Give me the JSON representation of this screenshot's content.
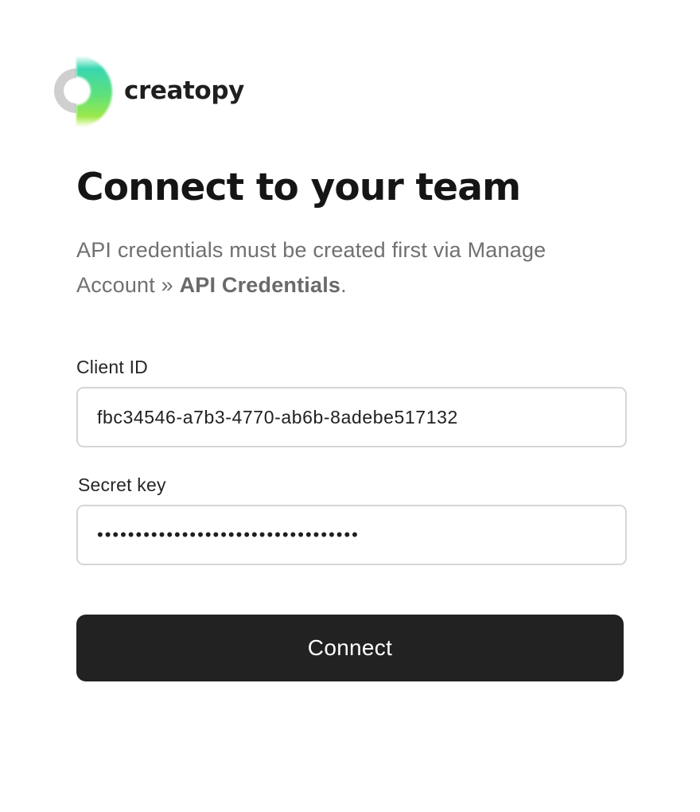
{
  "brand": {
    "name": "creatopy",
    "icon": "creatopy-logo-icon"
  },
  "header": {
    "title": "Connect to your team"
  },
  "description": {
    "text": "API credentials must be created first via Manage Account » ",
    "strong": "API Credentials",
    "suffix": "."
  },
  "form": {
    "client_id": {
      "label": "Client ID",
      "value": "fbc34546-a7b3-4770-ab6b-8adebe517132"
    },
    "secret_key": {
      "label": "Secret key",
      "value": "••••••••••••••••••••••••••••••••••"
    },
    "submit_label": "Connect"
  },
  "colors": {
    "button_bg": "#222222",
    "button_text": "#ffffff",
    "field_border": "#d6d6d6",
    "muted_text": "#707070",
    "logo_gray": "#cfcfcf",
    "logo_green": "#7fe05a",
    "logo_teal": "#38d7b0"
  }
}
